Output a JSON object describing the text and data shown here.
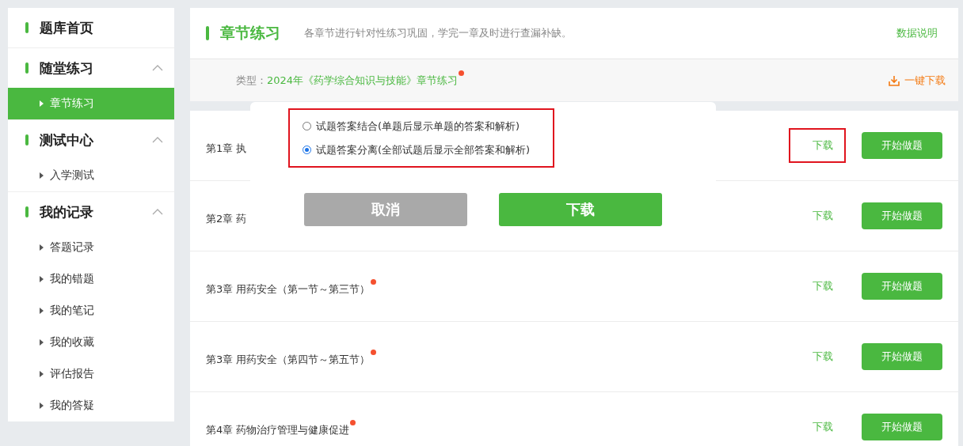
{
  "sidebar": {
    "groups": [
      {
        "title": "题库首页",
        "expanded": false
      },
      {
        "title": "随堂练习",
        "expanded": true,
        "items": [
          {
            "label": "章节练习",
            "selected": true
          }
        ]
      },
      {
        "title": "测试中心",
        "expanded": true,
        "items": [
          {
            "label": "入学测试",
            "selected": false
          }
        ]
      },
      {
        "title": "我的记录",
        "expanded": true,
        "items": [
          {
            "label": "答题记录",
            "selected": false
          },
          {
            "label": "我的错题",
            "selected": false
          },
          {
            "label": "我的笔记",
            "selected": false
          },
          {
            "label": "我的收藏",
            "selected": false
          },
          {
            "label": "评估报告",
            "selected": false
          },
          {
            "label": "我的答疑",
            "selected": false
          }
        ]
      }
    ]
  },
  "header": {
    "title": "章节练习",
    "description": "各章节进行针对性练习巩固，学完一章及时进行查漏补缺。",
    "link": "数据说明"
  },
  "type_bar": {
    "label": "类型：",
    "value": "2024年《药学综合知识与技能》章节练习",
    "new": true,
    "download_all": "一键下载"
  },
  "chapters": [
    {
      "title": "第1章 执",
      "download": "下载",
      "highlighted": true,
      "start": "开始做题"
    },
    {
      "title": "第2章 药",
      "download": "下载",
      "highlighted": false,
      "start": "开始做题"
    },
    {
      "title": "第3章 用药安全（第一节～第三节）",
      "new": true,
      "download": "下载",
      "highlighted": false,
      "start": "开始做题"
    },
    {
      "title": "第3章 用药安全（第四节～第五节）",
      "new": true,
      "download": "下载",
      "highlighted": false,
      "start": "开始做题"
    },
    {
      "title": "第4章 药物治疗管理与健康促进",
      "new": true,
      "download": "下载",
      "highlighted": false,
      "start": "开始做题"
    }
  ],
  "dialog": {
    "highlighted": true,
    "options": [
      {
        "label": "试题答案结合(单题后显示单题的答案和解析)",
        "selected": false
      },
      {
        "label": "试题答案分离(全部试题后显示全部答案和解析)",
        "selected": true
      }
    ],
    "cancel": "取消",
    "confirm": "下载"
  }
}
